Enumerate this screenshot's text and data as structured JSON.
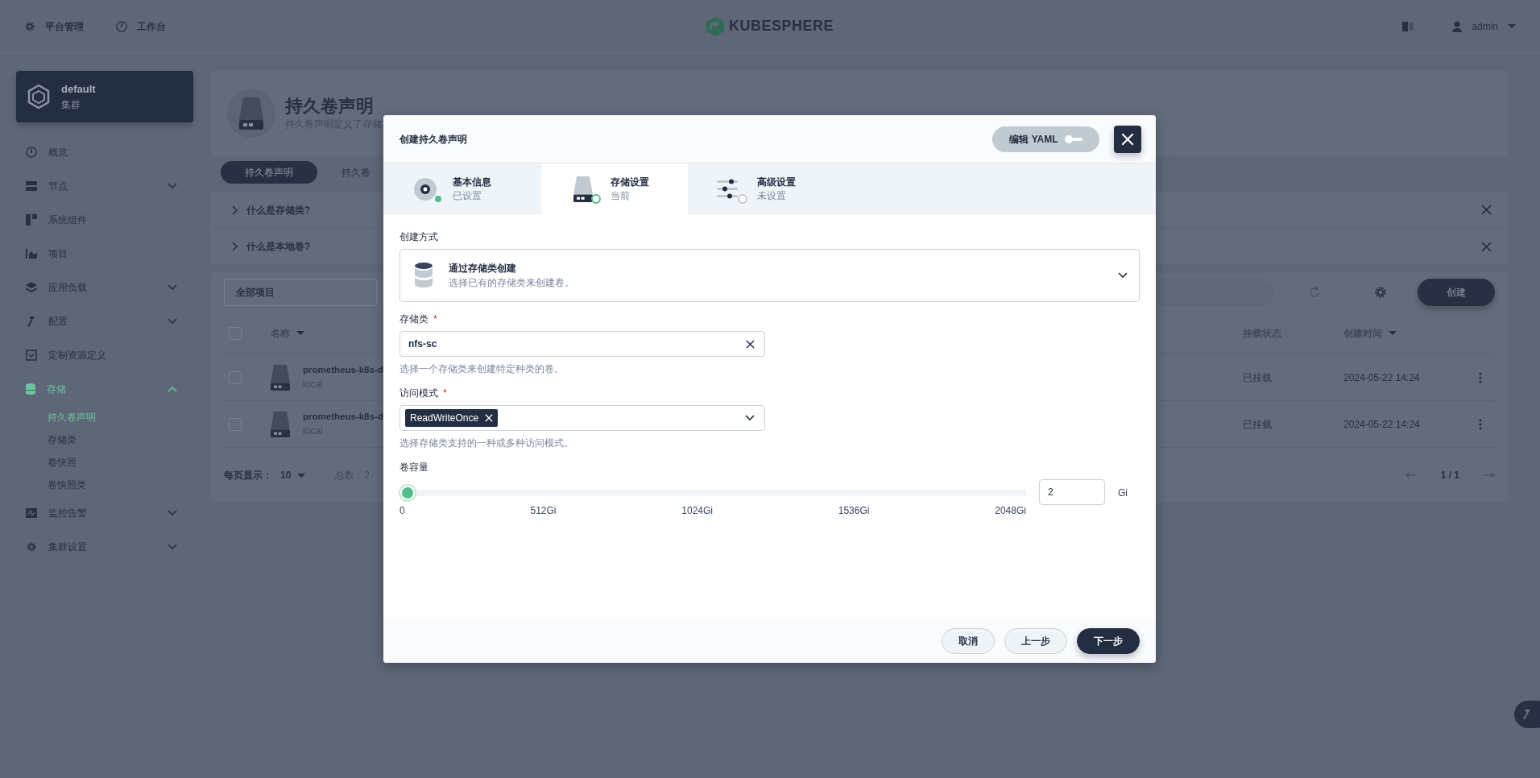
{
  "top_nav": {
    "items": [
      {
        "label": "平台管理"
      },
      {
        "label": "工作台"
      }
    ],
    "logo": "KUBESPHERE",
    "user": "admin"
  },
  "sidebar": {
    "cluster": {
      "name": "default",
      "type": "集群"
    },
    "items": [
      {
        "label": "概览",
        "expandable": false,
        "expanded": false,
        "selected": false
      },
      {
        "label": "节点",
        "expandable": true,
        "expanded": false,
        "selected": false
      },
      {
        "label": "系统组件",
        "expandable": false,
        "expanded": false,
        "selected": false
      },
      {
        "label": "项目",
        "expandable": false,
        "expanded": false,
        "selected": false
      },
      {
        "label": "应用负载",
        "expandable": true,
        "expanded": false,
        "selected": false
      },
      {
        "label": "配置",
        "expandable": true,
        "expanded": false,
        "selected": false
      },
      {
        "label": "定制资源定义",
        "expandable": false,
        "expanded": false,
        "selected": false
      },
      {
        "label": "存储",
        "expandable": true,
        "expanded": true,
        "selected": true,
        "children": [
          {
            "label": "持久卷声明",
            "selected": true
          },
          {
            "label": "存储类",
            "selected": false
          },
          {
            "label": "卷快照",
            "selected": false
          },
          {
            "label": "卷快照类",
            "selected": false
          }
        ]
      },
      {
        "label": "监控告警",
        "expandable": true,
        "expanded": false,
        "selected": false
      },
      {
        "label": "集群设置",
        "expandable": true,
        "expanded": false,
        "selected": false
      }
    ]
  },
  "page": {
    "title": "持久卷声明",
    "description": "持久卷声明定义了存储",
    "tabs": [
      {
        "label": "持久卷声明",
        "selected": true
      },
      {
        "label": "持久卷",
        "selected": false
      }
    ],
    "tips": [
      {
        "label": "什么是存储类?"
      },
      {
        "label": "什么是本地卷?"
      }
    ],
    "filter": "全部项目",
    "create_button": "创建",
    "table": {
      "select_all_checked": false,
      "columns": [
        {
          "label": "名称",
          "sortable": true
        },
        {
          "label": "挂载状态",
          "sortable": false
        },
        {
          "label": "创建时间",
          "sortable": true
        }
      ],
      "rows": [
        {
          "name": "prometheus-k8s-d",
          "storage": "local",
          "status": "已挂载",
          "created": "2024-05-22 14:24",
          "checked": false
        },
        {
          "name": "prometheus-k8s-d",
          "storage": "local",
          "status": "已挂载",
          "created": "2024-05-22 14:24",
          "checked": false
        }
      ]
    },
    "page_size_label": "每页显示：",
    "page_size": "10",
    "total": "总数：2",
    "pagination": "1 / 1"
  },
  "dialog": {
    "title": "创建持久卷声明",
    "yaml_toggle": {
      "label": "编辑 YAML",
      "on": false
    },
    "steps": [
      {
        "title": "基本信息",
        "status": "已设置",
        "done": true,
        "selected": false
      },
      {
        "title": "存储设置",
        "status": "当前",
        "done": false,
        "selected": true
      },
      {
        "title": "高级设置",
        "status": "未设置",
        "done": false,
        "selected": false
      }
    ],
    "method": {
      "label": "创建方式",
      "title": "通过存储类创建",
      "description": "选择已有的存储类来创建卷。"
    },
    "storage_class": {
      "label": "存储类",
      "required_mark": "*",
      "value": "nfs-sc",
      "hint": "选择一个存储类来创建特定种类的卷。"
    },
    "access_mode": {
      "label": "访问模式",
      "required_mark": "*",
      "tags": [
        "ReadWriteOnce"
      ],
      "hint": "选择存储类支持的一种或多种访问模式。"
    },
    "capacity": {
      "label": "卷容量",
      "level": 0.001,
      "ticks": [
        "0",
        "512Gi",
        "1024Gi",
        "1536Gi",
        "2048Gi"
      ],
      "value": "2",
      "unit": "Gi"
    },
    "buttons": [
      {
        "label": "取消",
        "kind": "secondary"
      },
      {
        "label": "上一步",
        "kind": "secondary"
      },
      {
        "label": "下一步",
        "kind": "primary"
      }
    ]
  }
}
